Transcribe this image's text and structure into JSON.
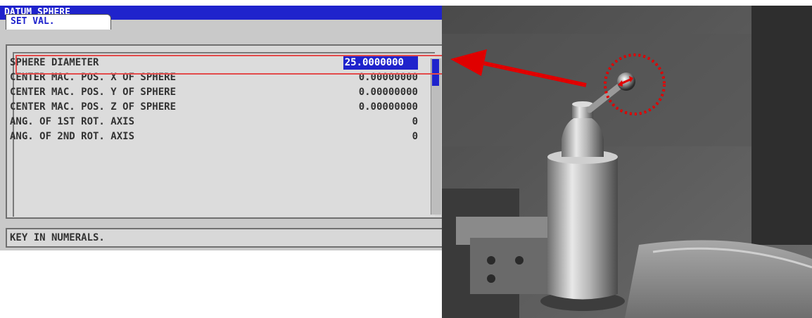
{
  "window": {
    "title": "DATUM SPHERE",
    "tab_label": "SET VAL."
  },
  "params": [
    {
      "label": "SPHERE DIAMETER",
      "value": "25.0000000",
      "selected": true
    },
    {
      "label": "CENTER MAC. POS. X OF SPHERE",
      "value": "0.00000000",
      "selected": false
    },
    {
      "label": "CENTER MAC. POS. Y OF SPHERE",
      "value": "0.00000000",
      "selected": false
    },
    {
      "label": "CENTER MAC. POS. Z OF SPHERE",
      "value": "0.00000000",
      "selected": false
    },
    {
      "label": "ANG. OF 1ST ROT. AXIS",
      "value": "0",
      "selected": false
    },
    {
      "label": "ANG. OF 2ND ROT. AXIS",
      "value": "0",
      "selected": false
    }
  ],
  "status_message": "KEY IN NUMERALS.",
  "colors": {
    "title_bar": "#1f23cc",
    "selection": "#1f23cc",
    "highlight": "#e34b4b",
    "arrow": "#e00000"
  }
}
